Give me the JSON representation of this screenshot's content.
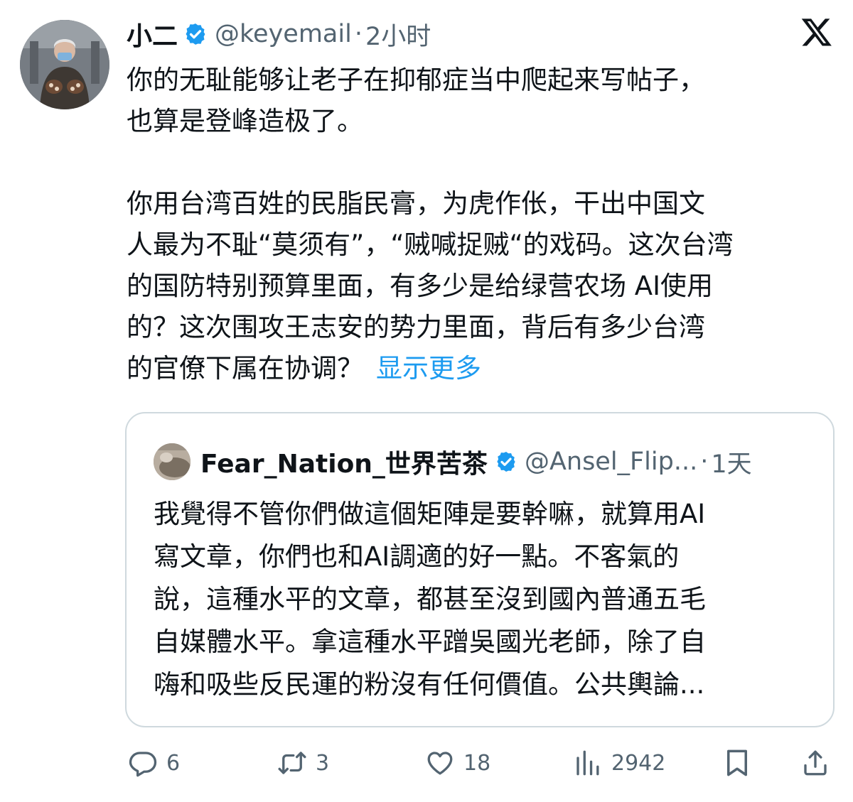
{
  "tweet": {
    "author": {
      "display_name": "小二",
      "handle": "@keyemail",
      "separator": "·",
      "time": "2小时"
    },
    "lines_para1": [
      "你的无耻能够让老子在抑郁症当中爬起来写帖子，",
      "也算是登峰造极了。"
    ],
    "lines_para2": [
      "你用台湾百姓的民脂民膏，为虎作伥，干出中国文",
      "人最为不耻“莫须有”，“贼喊捉贼“的戏码。这次台湾",
      "的国防特别预算里面，有多少是给绿营农场 AI使用",
      "的？这次围攻王志安的势力里面，背后有多少台湾"
    ],
    "last_line": "的官僚下属在协调？",
    "show_more": "显示更多"
  },
  "quote": {
    "author": {
      "display_name": "Fear_Nation_世界苦茶",
      "handle": "@Ansel_Flip...",
      "separator": "·",
      "time": "1天"
    },
    "lines": [
      "我覺得不管你們做這個矩陣是要幹嘛，就算用AI",
      "寫文章，你們也和AI調適的好一點。不客氣的",
      "說，這種水平的文章，都甚至沒到國內普通五毛",
      "自媒體水平。拿這種水平蹭吳國光老師，除了自",
      "嗨和吸些反民運的粉沒有任何價值。公共輿論..."
    ]
  },
  "actions": {
    "reply": {
      "icon": "reply-icon",
      "count": "6"
    },
    "repost": {
      "icon": "repost-icon",
      "count": "3"
    },
    "like": {
      "icon": "heart-icon",
      "count": "18"
    },
    "views": {
      "icon": "views-icon",
      "count": "2942"
    },
    "bookmark": {
      "icon": "bookmark-icon"
    },
    "share": {
      "icon": "share-icon"
    }
  },
  "colors": {
    "text": "#0f1419",
    "secondary": "#536471",
    "link": "#1d9bf0",
    "verified": "#1d9bf0",
    "border": "#cfd9de"
  }
}
